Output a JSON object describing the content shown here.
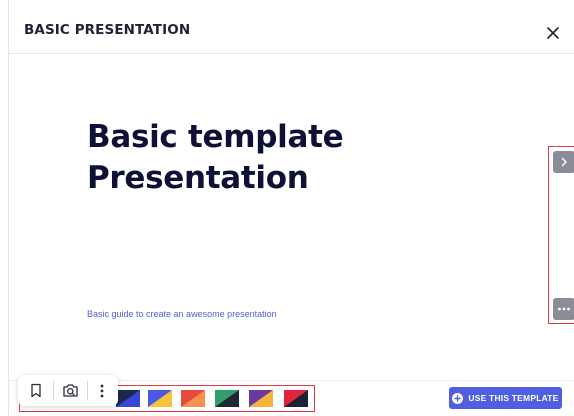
{
  "header": {
    "title": "BASIC PRESENTATION",
    "close_icon": "close-icon"
  },
  "slide": {
    "title_line1": "Basic template",
    "title_line2": "Presentation",
    "subtitle": "Basic guide to create an awesome presentation"
  },
  "side_nav": {
    "next_icon": "chevron-right-icon",
    "more_icon": "more-horizontal-icon"
  },
  "theme_swatches": [
    {
      "name": "theme-1",
      "colors": [
        "#1b2a4a",
        "#3846d8"
      ]
    },
    {
      "name": "theme-2",
      "colors": [
        "#4a58e6",
        "#f5c43a"
      ]
    },
    {
      "name": "theme-3",
      "colors": [
        "#e64a3b",
        "#f7904a"
      ]
    },
    {
      "name": "theme-4",
      "colors": [
        "#2e9e6a",
        "#1f2636"
      ]
    },
    {
      "name": "theme-5",
      "colors": [
        "#6b3aa0",
        "#f5b53a"
      ]
    },
    {
      "name": "theme-6",
      "colors": [
        "#e0243c",
        "#1d2233"
      ]
    }
  ],
  "footer": {
    "use_template_label": "USE THIS TEMPLATE",
    "use_template_icon": "plus-circle-icon"
  },
  "toolbar": {
    "items": [
      "bookmark-icon",
      "camera-search-icon",
      "more-vertical-icon"
    ]
  },
  "colors": {
    "primary": "#4f5fe0",
    "title_text": "#0d1136",
    "highlight": "#e53a4a",
    "nav_button": "#8a8d96"
  }
}
